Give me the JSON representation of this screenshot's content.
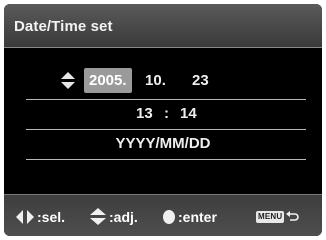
{
  "header": {
    "title": "Date/Time set"
  },
  "date": {
    "year": "2005",
    "year_sep": ".",
    "month": "10",
    "month_sep": ".",
    "day": "23"
  },
  "time": {
    "hour": "13",
    "sep": ":",
    "minute": "14"
  },
  "format": {
    "label": "YYYY/MM/DD"
  },
  "footer": {
    "select": {
      "icon": "left-right-arrows-icon",
      "label": ":sel."
    },
    "adjust": {
      "icon": "up-down-arrows-icon",
      "label": ":adj."
    },
    "enter": {
      "icon": "center-button-icon",
      "label": ":enter"
    },
    "menu": {
      "badge": "MENU",
      "icon": "return-arrow-icon"
    }
  },
  "colors": {
    "selection": "#9a9a9a",
    "header": "#4a4a4a",
    "background": "#000000"
  }
}
